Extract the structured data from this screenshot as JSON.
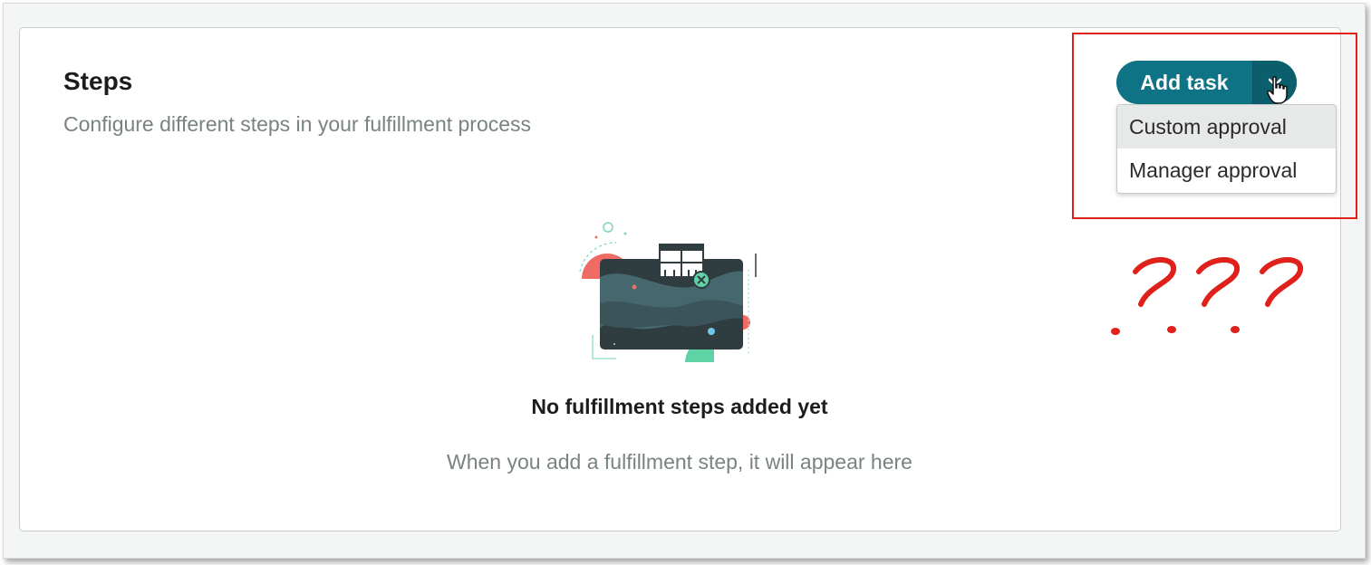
{
  "steps": {
    "title": "Steps",
    "subtitle": "Configure different steps in your fulfillment process"
  },
  "empty_state": {
    "title": "No fulfillment steps added yet",
    "description": "When you add a fulfillment step, it will appear here",
    "illustration": "empty-folder-illustration"
  },
  "add_task": {
    "label": "Add task",
    "toggle_icon": "chevron-down-icon"
  },
  "dropdown": {
    "items": [
      {
        "label": "Custom approval",
        "highlighted": true
      },
      {
        "label": "Manager approval",
        "highlighted": false
      }
    ]
  },
  "annotation": {
    "text": "???",
    "color": "#e0201b"
  },
  "colors": {
    "accent": "#0e7384",
    "accent_dark": "#0b5e6c",
    "muted_text": "#7a8383"
  }
}
